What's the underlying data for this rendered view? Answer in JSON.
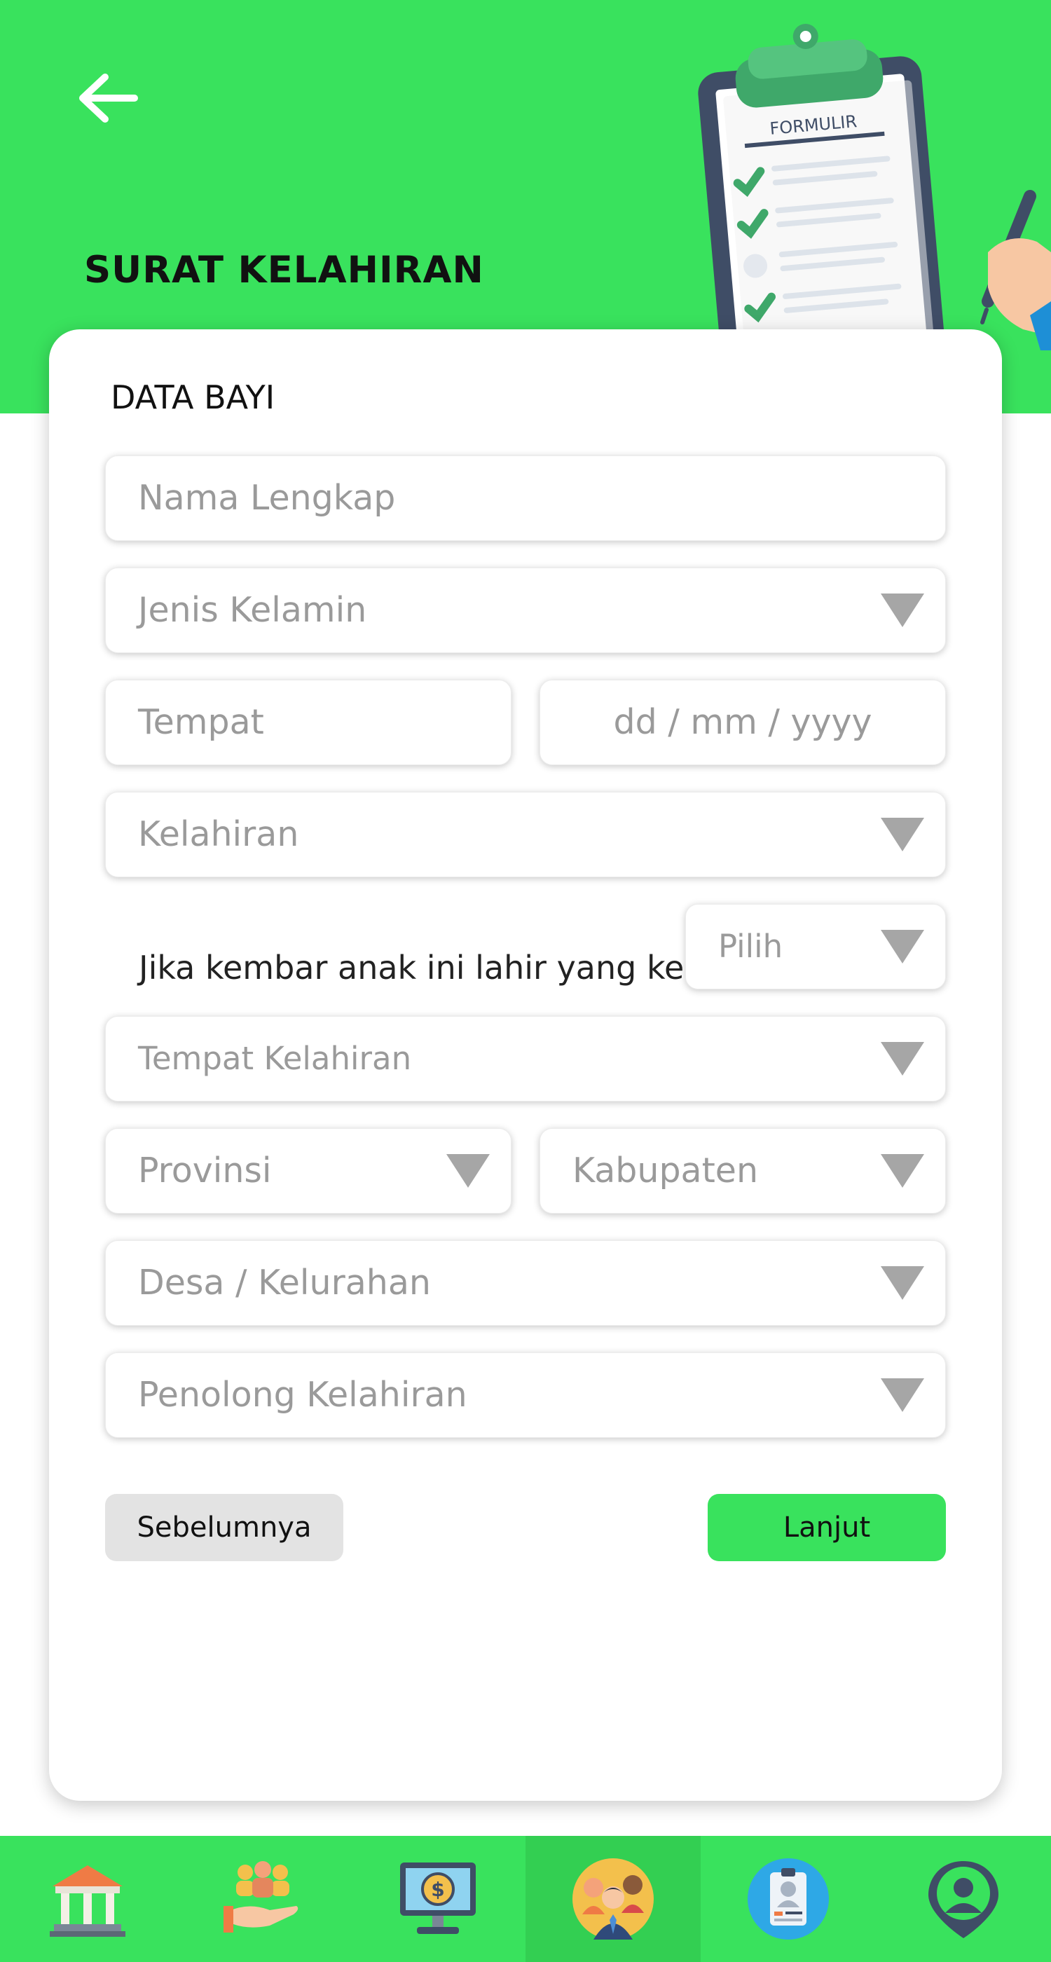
{
  "header": {
    "title": "SURAT KELAHIRAN",
    "back_icon": "arrow-left-icon",
    "illustration_label": "FORMULIR",
    "background_color": "#39e25d"
  },
  "form": {
    "section_title": "DATA BAYI",
    "fields": {
      "nama_lengkap": "Nama Lengkap",
      "jenis_kelamin": "Jenis Kelamin",
      "tempat": "Tempat",
      "tanggal": "dd / mm / yyyy",
      "kelahiran": "Kelahiran",
      "kembar_label": "Jika kembar anak ini lahir yang ke",
      "kembar_select": "Pilih",
      "tempat_kelahiran": "Tempat Kelahiran",
      "provinsi": "Provinsi",
      "kabupaten": "Kabupaten",
      "desa": "Desa / Kelurahan",
      "penolong": "Penolong Kelahiran"
    },
    "buttons": {
      "prev": "Sebelumnya",
      "next": "Lanjut"
    }
  },
  "navbar": {
    "items": [
      {
        "icon": "government-building-icon",
        "active": false
      },
      {
        "icon": "community-hand-icon",
        "active": false
      },
      {
        "icon": "monitor-dollar-icon",
        "active": false
      },
      {
        "icon": "people-group-icon",
        "active": true
      },
      {
        "icon": "id-card-icon",
        "active": false
      },
      {
        "icon": "location-person-icon",
        "active": false
      }
    ]
  },
  "colors": {
    "accent": "#39e25d",
    "accent_active": "#33cf52",
    "placeholder": "#9a9a9a"
  }
}
